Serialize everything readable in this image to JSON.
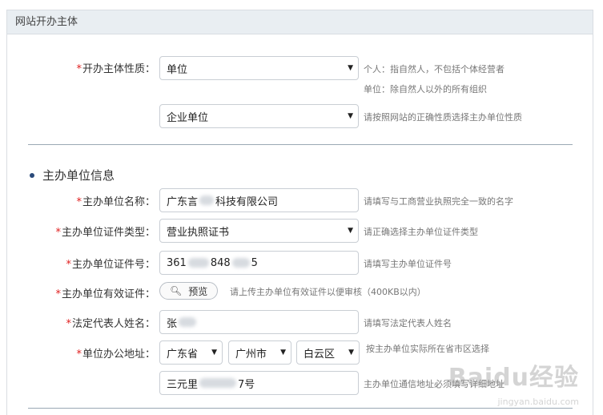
{
  "panel": {
    "title": "网站开办主体"
  },
  "nature": {
    "label": "开办主体性质：",
    "select_value": "单位",
    "hint_line1": "个人：指自然人，不包括个体经营者",
    "hint_line2": "单位：除自然人以外的所有组织",
    "sub_select_value": "企业单位",
    "sub_hint": "请按照网站的正确性质选择主办单位性质"
  },
  "section": {
    "title": "主办单位信息"
  },
  "fields": {
    "unit_name": {
      "label": "主办单位名称：",
      "value_prefix": "广东言",
      "value_suffix": "科技有限公司",
      "hint": "请填写与工商营业执照完全一致的名字"
    },
    "cert_type": {
      "label": "主办单位证件类型：",
      "value": "营业执照证书",
      "hint": "请正确选择主办单位证件类型"
    },
    "cert_no": {
      "label": "主办单位证件号：",
      "value_prefix": "361",
      "value_mid": "848",
      "value_suffix": "5",
      "hint": "请填写主办单位证件号"
    },
    "cert_upload": {
      "label": "主办单位有效证件：",
      "button": "预览",
      "hint": "请上传主办单位有效证件以便审核（400KB以内）"
    },
    "legal_rep": {
      "label": "法定代表人姓名：",
      "value_prefix": "张",
      "hint": "请填写法定代表人姓名"
    },
    "address": {
      "label": "单位办公地址：",
      "province": "广东省",
      "city": "广州市",
      "district": "白云区",
      "hint": "按主办单位实际所在省市区选择",
      "street_prefix": "三元里",
      "street_suffix": "7号",
      "street_hint": "主办单位通信地址必须填写详细地址"
    }
  },
  "watermark": {
    "main": "Baidu经验",
    "sub": "jingyan.baidu.com"
  },
  "icons": {
    "dropdown": "dropdown-triangle-icon",
    "search": "magnifier-icon"
  }
}
